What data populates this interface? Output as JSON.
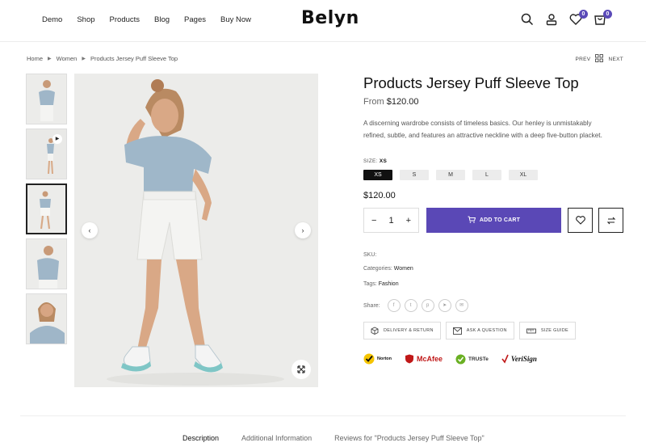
{
  "header": {
    "nav": [
      "Demo",
      "Shop",
      "Products",
      "Blog",
      "Pages",
      "Buy Now"
    ],
    "logo": "Belyn",
    "wishlist_count": "0",
    "cart_count": "0"
  },
  "breadcrumb": [
    "Home",
    "Women",
    "Products Jersey Puff Sleeve Top"
  ],
  "pager": {
    "prev": "PREV",
    "next": "NEXT"
  },
  "product": {
    "title": "Products Jersey Puff Sleeve Top",
    "from_label": "From",
    "from_price": "$120.00",
    "description": "A discerning wardrobe consists of timeless basics. Our henley is unmistakably refined, subtle, and features an attractive neckline with a deep five-button placket.",
    "size_label": "SIZE:",
    "size_selected": "XS",
    "sizes": [
      "XS",
      "S",
      "M",
      "L",
      "XL"
    ],
    "price": "$120.00",
    "quantity": "1",
    "add_to_cart": "ADD TO CART",
    "sku_label": "SKU:",
    "categories_label": "Categories:",
    "categories_value": "Women",
    "tags_label": "Tags:",
    "tags_value": "Fashion",
    "share_label": "Share:",
    "social_icons": [
      "facebook-icon",
      "twitter-icon",
      "pinterest-icon",
      "telegram-icon",
      "email-icon"
    ],
    "options": [
      "DELIVERY & RETURN",
      "ASK A QUESTION",
      "SIZE GUIDE"
    ],
    "trust_badges": [
      "Norton",
      "McAfee",
      "TRUSTe",
      "VeriSign"
    ]
  },
  "tabs": [
    "Description",
    "Additional Information",
    "Reviews for \"Products Jersey Puff Sleeve Top\""
  ],
  "colors": {
    "accent": "#5a48b6",
    "selected_size": "#111111"
  }
}
